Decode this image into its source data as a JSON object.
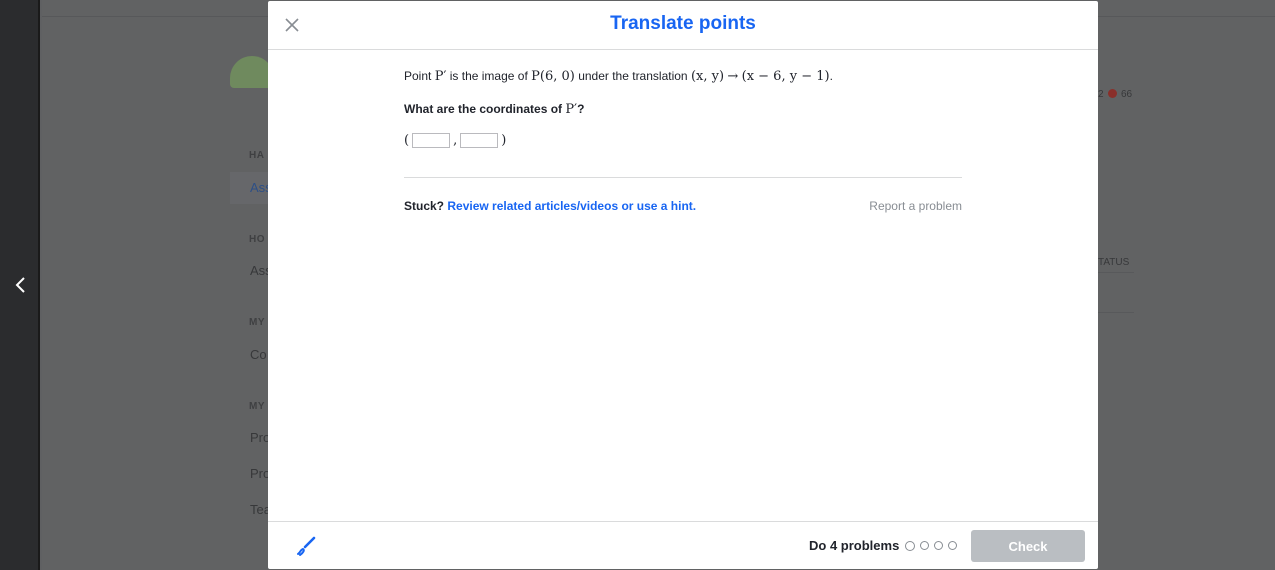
{
  "background": {
    "labels": [
      "HA",
      "HO",
      "MY",
      "MY"
    ],
    "active_link": "Ass",
    "items": [
      "Ass",
      "Co",
      "Pro",
      "Pro",
      "Tea"
    ],
    "stats": "2",
    "energy": "66",
    "status_header": "TATUS"
  },
  "modal": {
    "title": "Translate points",
    "question_prefix": "Point",
    "question_point_prime": "P′",
    "question_mid": "is the image of",
    "question_point": "P(6, 0)",
    "question_under": "under the translation",
    "question_map_from": "(x, y)",
    "question_arrow": "→",
    "question_map_to": "(x − 6, y − 1)",
    "question_end": ".",
    "prompt_prefix": "What are the coordinates of",
    "prompt_point": "P′",
    "prompt_suffix": "?",
    "answer_open": "(",
    "answer_comma": ",",
    "answer_close": ")",
    "answer_x_value": "",
    "answer_y_value": "",
    "stuck_label": "Stuck?",
    "hint_link": "Review related articles/videos or use a hint.",
    "report_link": "Report a problem",
    "do_problems": "Do 4 problems",
    "check_label": "Check"
  },
  "colors": {
    "accent": "#1865f2",
    "check_disabled": "#babec2"
  },
  "icons": [
    "close-icon",
    "back-chevron-icon",
    "scratchpad-pencil-icon"
  ]
}
